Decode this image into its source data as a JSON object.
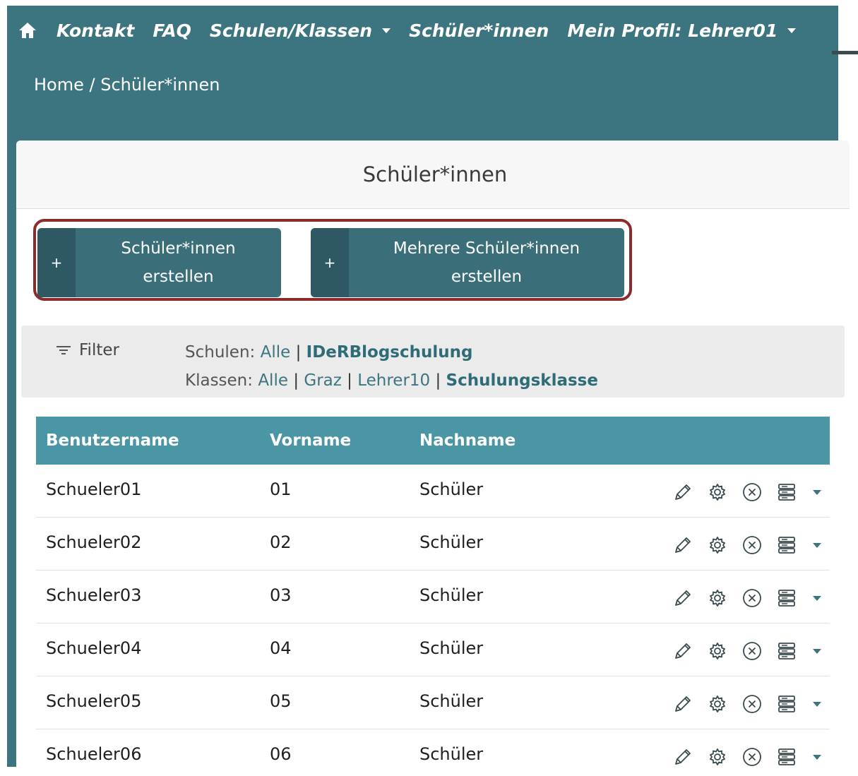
{
  "nav": {
    "items": [
      {
        "label": "Kontakt",
        "dropdown": false
      },
      {
        "label": "FAQ",
        "dropdown": false
      },
      {
        "label": "Schulen/Klassen",
        "dropdown": true
      },
      {
        "label": "Schüler*innen",
        "dropdown": false
      },
      {
        "label": "Mein Profil: Lehrer01",
        "dropdown": true
      }
    ]
  },
  "breadcrumb": {
    "home": "Home",
    "separator": " / ",
    "current": "Schüler*innen"
  },
  "card": {
    "title": "Schüler*innen"
  },
  "buttons": {
    "create_single": {
      "plus": "+",
      "line1": "Schüler*innen",
      "line2": "erstellen"
    },
    "create_multiple": {
      "plus": "+",
      "line1": "Mehrere Schüler*innen",
      "line2": "erstellen"
    }
  },
  "filter": {
    "toggle_label": "Filter",
    "schools_prefix": "Schulen:",
    "schools": [
      "Alle",
      "IDeRBlogschulung"
    ],
    "schools_active": "IDeRBlogschulung",
    "classes_prefix": "Klassen:",
    "classes": [
      "Alle",
      "Graz",
      "Lehrer10",
      "Schulungsklasse"
    ],
    "classes_active": "Schulungsklasse"
  },
  "table": {
    "headers": [
      "Benutzername",
      "Vorname",
      "Nachname"
    ],
    "rows": [
      {
        "username": "Schueler01",
        "firstname": "01",
        "lastname": "Schüler"
      },
      {
        "username": "Schueler02",
        "firstname": "02",
        "lastname": "Schüler"
      },
      {
        "username": "Schueler03",
        "firstname": "03",
        "lastname": "Schüler"
      },
      {
        "username": "Schueler04",
        "firstname": "04",
        "lastname": "Schüler"
      },
      {
        "username": "Schueler05",
        "firstname": "05",
        "lastname": "Schüler"
      },
      {
        "username": "Schueler06",
        "firstname": "06",
        "lastname": "Schüler"
      }
    ],
    "row_actions": [
      "pencil-icon",
      "gear-icon",
      "delete-circle-icon",
      "list-icon",
      "chevron-down-icon"
    ]
  },
  "colors": {
    "brand_teal": "#3c7580",
    "header_teal": "#4a96a4",
    "button_teal": "#3a6f7a",
    "highlight_red": "#8c2b2b"
  }
}
